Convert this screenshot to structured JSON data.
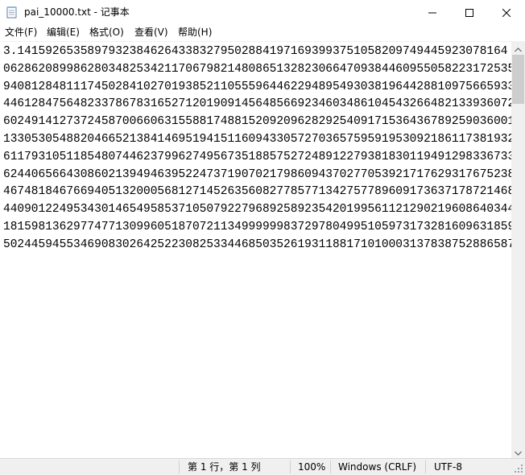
{
  "window": {
    "title": "pai_10000.txt - 记事本"
  },
  "menu": {
    "items": [
      {
        "label": "文件(F)"
      },
      {
        "label": "编辑(E)"
      },
      {
        "label": "格式(O)"
      },
      {
        "label": "查看(V)"
      },
      {
        "label": "帮助(H)"
      }
    ]
  },
  "editor": {
    "lines": [
      "3.1415926535897932384626433832795028841971693993751058209749445923078164",
      "0628620899862803482534211706798214808651328230664709384460955058223172535",
      "9408128481117450284102701938521105559644622948954930381964428810975665933",
      "4461284756482337867831652712019091456485669234603486104543266482133936072",
      "6024914127372458700660631558817488152092096282925409171536436789259036001",
      "1330530548820466521384146951941511609433057270365759591953092186117381932",
      "6117931051185480744623799627495673518857527248912279381830119491298336733",
      "6244065664308602139494639522473719070217986094370277053921717629317675238",
      "4674818467669405132000568127145263560827785771342757789609173637178721468",
      "4409012249534301465495853710507922796892589235420199561121290219608640344",
      "1815981362977477130996051870721134999999837297804995105973173281609631859",
      "5024459455346908302642522308253344685035261931188171010003137838752886587"
    ]
  },
  "status": {
    "position": "第 1 行，第 1 列",
    "zoom": "100%",
    "line_ending": "Windows (CRLF)",
    "encoding": "UTF-8"
  },
  "icons": {
    "app": "notepad-icon",
    "minimize": "minimize-icon",
    "maximize": "maximize-icon",
    "close": "close-icon",
    "scroll_up": "chevron-up-icon",
    "scroll_down": "chevron-down-icon",
    "grip": "resize-grip-icon"
  }
}
